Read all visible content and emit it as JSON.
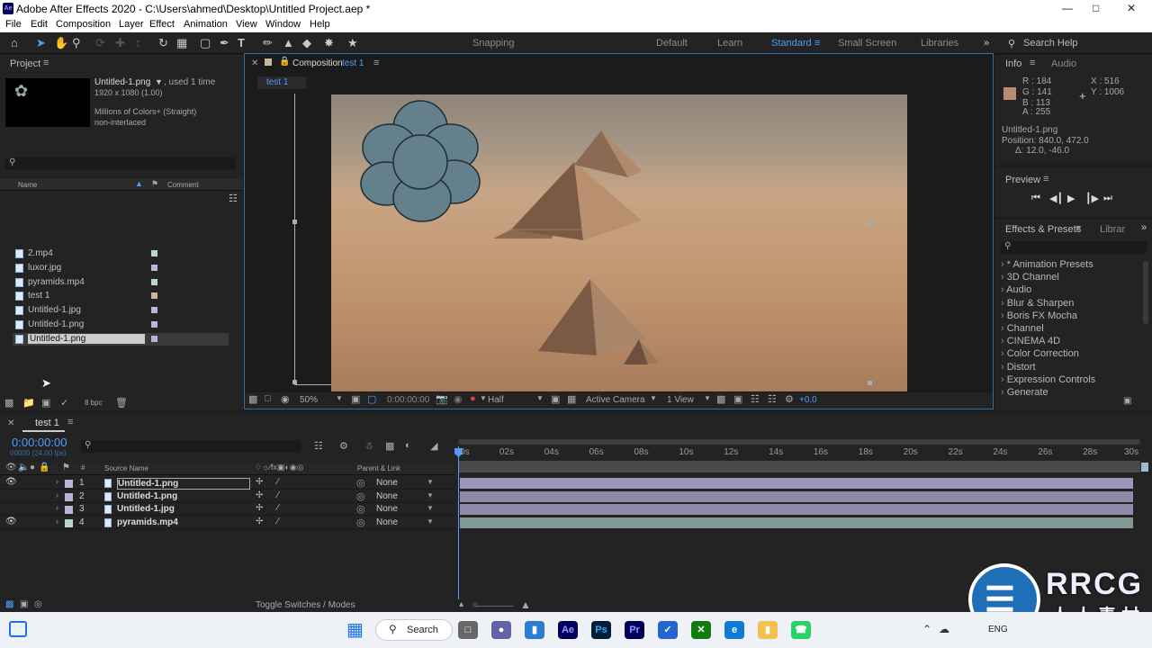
{
  "window": {
    "title": "Adobe After Effects 2020 - C:\\Users\\ahmed\\Desktop\\Untitled Project.aep *",
    "app_icon": "Ae"
  },
  "menu": [
    "File",
    "Edit",
    "Composition",
    "Layer",
    "Effect",
    "Animation",
    "View",
    "Window",
    "Help"
  ],
  "toolbar": {
    "snapping": "Snapping",
    "workspaces": [
      "Default",
      "Learn",
      "Standard",
      "Small Screen",
      "Libraries"
    ],
    "active_workspace": "Standard",
    "search_help": "Search Help"
  },
  "project": {
    "title": "Project",
    "selected_name": "Untitled-1.png",
    "used": ", used 1 time",
    "dims": "1920 x 1080 (1.00)",
    "colors": "Millions of Colors+ (Straight)",
    "interlace": "non-interlaced",
    "col_name": "Name",
    "col_comment": "Comment",
    "items": [
      {
        "name": "2.mp4",
        "color": "#b9d7c5"
      },
      {
        "name": "luxor.jpg",
        "color": "#b8b6d6"
      },
      {
        "name": "pyramids.mp4",
        "color": "#b9d7c5"
      },
      {
        "name": "test 1",
        "color": "#c9b79b"
      },
      {
        "name": "Untitled-1.jpg",
        "color": "#b8b6d6"
      },
      {
        "name": "Untitled-1.png",
        "color": "#b8b6d6"
      },
      {
        "name": "Untitled-1.png",
        "color": "#b8b6d6"
      }
    ],
    "bpc": "8 bpc"
  },
  "composition": {
    "tab_label": "Composition",
    "tab_name": "test 1",
    "crumb": "test 1",
    "zoom": "50%",
    "timecode": "0:00:00:00",
    "resolution": "Half",
    "camera": "Active Camera",
    "view": "1 View",
    "exposure": "+0.0"
  },
  "info": {
    "tab": "Info",
    "tab2": "Audio",
    "R": "R : 184",
    "G": "G : 141",
    "B": "B : 113",
    "A": "A : 255",
    "X": "X : 516",
    "Y": "Y : 1006",
    "swatch": "#b88d71",
    "layer": "Untitled-1.png",
    "position": "Position: 840.0, 472.0",
    "delta": "Δ: 12.0, -46.0"
  },
  "preview": {
    "title": "Preview"
  },
  "effects": {
    "title": "Effects & Presets",
    "tab2": "Librar",
    "items": [
      "* Animation Presets",
      "3D Channel",
      "Audio",
      "Blur & Sharpen",
      "Boris FX Mocha",
      "Channel",
      "CINEMA 4D",
      "Color Correction",
      "Distort",
      "Expression Controls",
      "Generate"
    ]
  },
  "timeline": {
    "tab": "test 1",
    "timecode": "0:00:00:00",
    "fps": "00000 (24.00 fps)",
    "col_source": "Source Name",
    "col_parent": "Parent & Link",
    "toggle": "Toggle Switches / Modes",
    "ticks": [
      "0s",
      "02s",
      "04s",
      "06s",
      "08s",
      "10s",
      "12s",
      "14s",
      "16s",
      "18s",
      "20s",
      "22s",
      "24s",
      "26s",
      "28s",
      "30s"
    ],
    "layers": [
      {
        "num": "1",
        "name": "Untitled-1.png",
        "parent": "None",
        "color": "#b8b6d6",
        "bar": "#9d95b8"
      },
      {
        "num": "2",
        "name": "Untitled-1.png",
        "parent": "None",
        "color": "#b8b6d6",
        "bar": "#8f8aa8"
      },
      {
        "num": "3",
        "name": "Untitled-1.jpg",
        "parent": "None",
        "color": "#b8b6d6",
        "bar": "#8f8aa8"
      },
      {
        "num": "4",
        "name": "pyramids.mp4",
        "parent": "None",
        "color": "#b9d7c5",
        "bar": "#7f9a94"
      }
    ]
  },
  "taskbar": {
    "search": "Search",
    "lang": "ENG",
    "watermark": "RRCG",
    "watermark_sub": "人人素材"
  }
}
